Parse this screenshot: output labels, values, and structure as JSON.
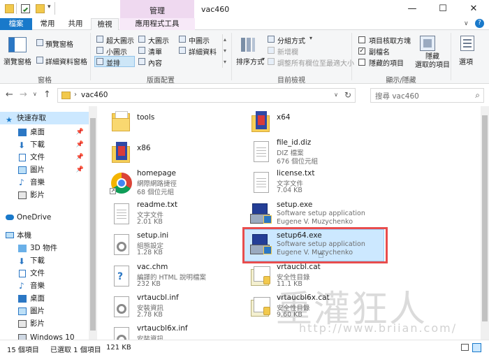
{
  "window": {
    "title": "vac460",
    "manage_tab": "管理"
  },
  "tabs": {
    "file": "檔案",
    "home": "常用",
    "share": "共用",
    "view": "檢視",
    "app_tools": "應用程式工具"
  },
  "ribbon": {
    "pane_group": {
      "nav_pane": "瀏覽窗格",
      "preview": "預覽窗格",
      "details": "詳細資料窗格",
      "label": "窗格"
    },
    "layout_group": {
      "xl_icons": "超大圖示",
      "large_icons": "大圖示",
      "medium_icons": "中圖示",
      "small_icons": "小圖示",
      "list": "清單",
      "details": "詳細資料",
      "tiles": "並排",
      "content": "內容",
      "label": "版面配置"
    },
    "current_view_group": {
      "sort_by": "排序方式",
      "group_by": "分組方式",
      "add_columns": "新增欄",
      "size_all_columns": "調整所有欄位至最適大小",
      "label": "目前檢視"
    },
    "show_hide_group": {
      "item_checkboxes": "項目核取方塊",
      "file_extensions": "副檔名",
      "hidden_items": "隱藏的項目",
      "hide_selected": "隱藏\n選取的項目",
      "label": "顯示/隱藏"
    },
    "options": "選項"
  },
  "address": {
    "path": "vac460",
    "search_placeholder": "搜尋 vac460"
  },
  "nav": [
    {
      "label": "快速存取",
      "pinned": false
    },
    {
      "label": "桌面",
      "pinned": true
    },
    {
      "label": "下載",
      "pinned": true
    },
    {
      "label": "文件",
      "pinned": true
    },
    {
      "label": "圖片",
      "pinned": true
    },
    {
      "label": "音樂",
      "pinned": false
    },
    {
      "label": "影片",
      "pinned": false
    },
    {
      "label": "OneDrive",
      "pinned": false
    },
    {
      "label": "本機",
      "pinned": false
    },
    {
      "label": "3D 物件",
      "pinned": false
    },
    {
      "label": "下載",
      "pinned": false
    },
    {
      "label": "文件",
      "pinned": false
    },
    {
      "label": "音樂",
      "pinned": false
    },
    {
      "label": "桌面",
      "pinned": false
    },
    {
      "label": "圖片",
      "pinned": false
    },
    {
      "label": "影片",
      "pinned": false
    },
    {
      "label": "Windows 10 (C:)",
      "pinned": false
    }
  ],
  "files": [
    {
      "name": "tools",
      "line2": "",
      "line3": "",
      "icon": "folder-icon"
    },
    {
      "name": "x64",
      "line2": "",
      "line3": "",
      "icon": "folder-app-icon"
    },
    {
      "name": "x86",
      "line2": "",
      "line3": "",
      "icon": "folder-app-icon"
    },
    {
      "name": "file_id.diz",
      "line2": "DIZ 檔案",
      "line3": "676 個位元組",
      "icon": "document-icon"
    },
    {
      "name": "homepage",
      "line2": "網際網路捷徑",
      "line3": "68 個位元組",
      "icon": "chrome-icon"
    },
    {
      "name": "license.txt",
      "line2": "文字文件",
      "line3": "7.04 KB",
      "icon": "document-icon"
    },
    {
      "name": "readme.txt",
      "line2": "文字文件",
      "line3": "2.01 KB",
      "icon": "document-icon"
    },
    {
      "name": "setup.exe",
      "line2": "Software setup application",
      "line3": "Eugene V. Muzychenko",
      "icon": "installer-icon"
    },
    {
      "name": "setup.ini",
      "line2": "組態設定",
      "line3": "1.28 KB",
      "icon": "config-icon"
    },
    {
      "name": "setup64.exe",
      "line2": "Software setup application",
      "line3": "Eugene V. Muzychenko",
      "icon": "installer-icon"
    },
    {
      "name": "vac.chm",
      "line2": "編譯的 HTML 說明檔案",
      "line3": "232 KB",
      "icon": "chm-icon"
    },
    {
      "name": "vrtaucbl.cat",
      "line2": "安全性目錄",
      "line3": "11.1 KB",
      "icon": "catalog-icon"
    },
    {
      "name": "vrtaucbl.inf",
      "line2": "安裝資訊",
      "line3": "2.78 KB",
      "icon": "config-icon"
    },
    {
      "name": "vrtaucbl6x.cat",
      "line2": "安全性目錄",
      "line3": "9.60 KB",
      "icon": "catalog-icon"
    },
    {
      "name": "vrtaucbl6x.inf",
      "line2": "安裝資訊",
      "line3": "",
      "icon": "config-icon"
    }
  ],
  "status": {
    "count": "15 個項目",
    "selected": "已選取 1 個項目",
    "size": "121 KB"
  },
  "watermark": {
    "text": "重灌狂人",
    "url": "http://www.briian.com/"
  },
  "colors": {
    "accent": "#1979ca",
    "selection": "#cce8ff",
    "highlight": "#e84d4d",
    "manage": "#efd9f0"
  }
}
